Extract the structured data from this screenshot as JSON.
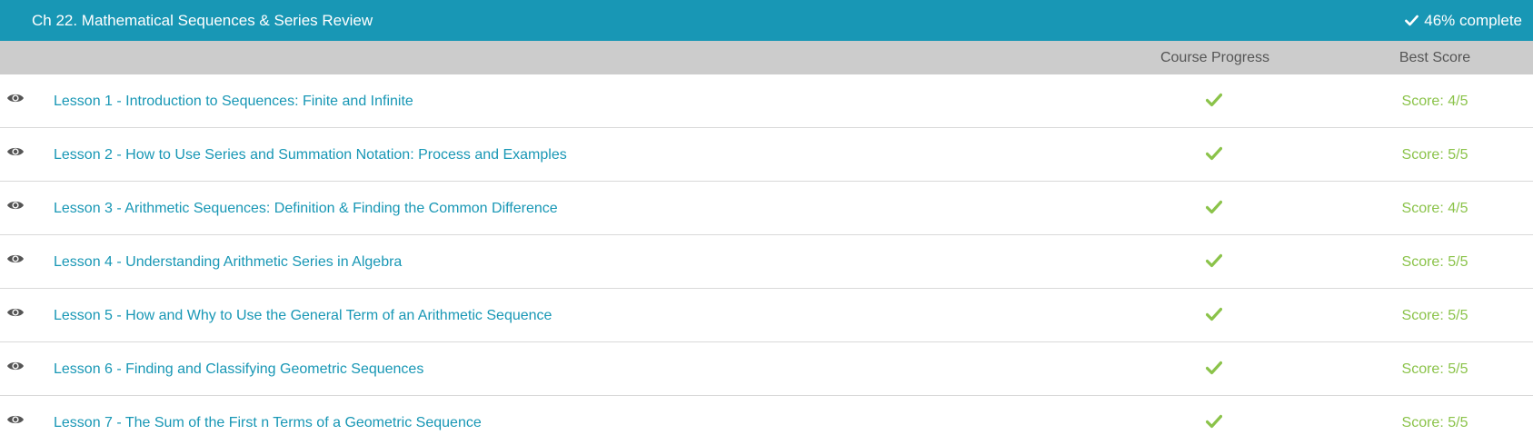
{
  "header": {
    "title": "Ch 22. Mathematical Sequences & Series Review",
    "progress_text": "46% complete",
    "progress_percent": 46
  },
  "columns": {
    "course_progress": "Course Progress",
    "best_score": "Best Score"
  },
  "colors": {
    "accent": "#1897b5",
    "success": "#8bc34a",
    "header_bar": "#cccccc"
  },
  "lessons": [
    {
      "title": "Lesson 1 - Introduction to Sequences: Finite and Infinite",
      "completed": true,
      "score": "Score: 4/5"
    },
    {
      "title": "Lesson 2 - How to Use Series and Summation Notation: Process and Examples",
      "completed": true,
      "score": "Score: 5/5"
    },
    {
      "title": "Lesson 3 - Arithmetic Sequences: Definition & Finding the Common Difference",
      "completed": true,
      "score": "Score: 4/5"
    },
    {
      "title": "Lesson 4 - Understanding Arithmetic Series in Algebra",
      "completed": true,
      "score": "Score: 5/5"
    },
    {
      "title": "Lesson 5 - How and Why to Use the General Term of an Arithmetic Sequence",
      "completed": true,
      "score": "Score: 5/5"
    },
    {
      "title": "Lesson 6 - Finding and Classifying Geometric Sequences",
      "completed": true,
      "score": "Score: 5/5"
    },
    {
      "title": "Lesson 7 - The Sum of the First n Terms of a Geometric Sequence",
      "completed": true,
      "score": "Score: 5/5"
    }
  ],
  "icons": {
    "row_view": "eye-icon",
    "row_status": "checkmark-icon",
    "header_status": "checkmark-icon"
  }
}
